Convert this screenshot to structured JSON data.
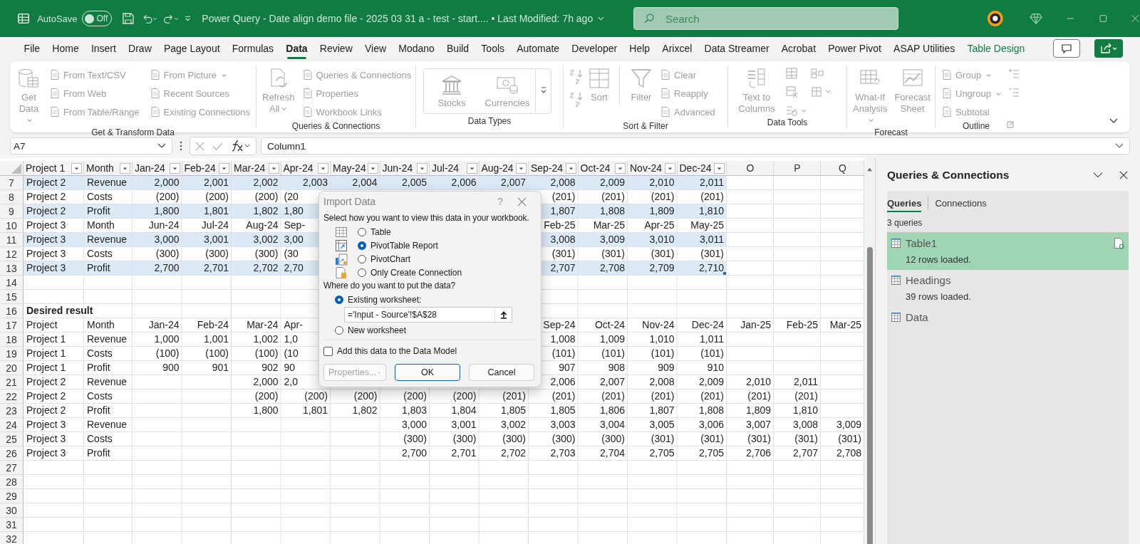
{
  "title_bar": {
    "autosave_label": "AutoSave",
    "autosave": {
      "on": false,
      "label": "Off"
    },
    "title": "Power Query - Date align demo file - 2025 03 31 a - test - start.... • Last Modified: 7h ago",
    "search": {
      "placeholder": "Search"
    }
  },
  "menu_tabs": [
    {
      "label": "File",
      "selected": false,
      "kind": "standard"
    },
    {
      "label": "Home",
      "selected": false,
      "kind": "standard"
    },
    {
      "label": "Insert",
      "selected": false,
      "kind": "standard"
    },
    {
      "label": "Draw",
      "selected": false,
      "kind": "standard"
    },
    {
      "label": "Page Layout",
      "selected": false,
      "kind": "standard"
    },
    {
      "label": "Formulas",
      "selected": false,
      "kind": "standard"
    },
    {
      "label": "Data",
      "selected": true,
      "kind": "standard"
    },
    {
      "label": "Review",
      "selected": false,
      "kind": "standard"
    },
    {
      "label": "View",
      "selected": false,
      "kind": "standard"
    },
    {
      "label": "Modano",
      "selected": false,
      "kind": "standard"
    },
    {
      "label": "Build",
      "selected": false,
      "kind": "standard"
    },
    {
      "label": "Tools",
      "selected": false,
      "kind": "standard"
    },
    {
      "label": "Automate",
      "selected": false,
      "kind": "standard"
    },
    {
      "label": "Developer",
      "selected": false,
      "kind": "standard"
    },
    {
      "label": "Help",
      "selected": false,
      "kind": "standard"
    },
    {
      "label": "Arixcel",
      "selected": false,
      "kind": "standard"
    },
    {
      "label": "Data Streamer",
      "selected": false,
      "kind": "standard"
    },
    {
      "label": "Acrobat",
      "selected": false,
      "kind": "standard"
    },
    {
      "label": "Power Pivot",
      "selected": false,
      "kind": "standard"
    },
    {
      "label": "ASAP Utilities",
      "selected": false,
      "kind": "standard"
    },
    {
      "label": "Table Design",
      "selected": false,
      "kind": "contextual"
    }
  ],
  "ribbon": {
    "disabled": true,
    "groups": [
      {
        "label": "Get & Transform Data",
        "large": [
          {
            "label": "Get Data",
            "caret": true
          }
        ],
        "small": [
          {
            "label": "From Text/CSV",
            "caret": false
          },
          {
            "label": "From Web",
            "caret": false
          },
          {
            "label": "From Table/Range",
            "caret": false
          },
          {
            "label": "From Picture",
            "caret": true
          },
          {
            "label": "Recent Sources",
            "caret": false
          },
          {
            "label": "Existing Connections",
            "caret": false
          }
        ]
      },
      {
        "label": "Queries & Connections",
        "large": [
          {
            "label": "Refresh All",
            "caret": true
          }
        ],
        "small": [
          {
            "label": "Queries & Connections",
            "caret": false
          },
          {
            "label": "Properties",
            "caret": false
          },
          {
            "label": "Workbook Links",
            "caret": false
          }
        ]
      },
      {
        "label": "Data Types",
        "gallery": [
          "Stocks",
          "Currencies"
        ]
      },
      {
        "label": "Sort & Filter",
        "large": [
          {
            "label": "Sort",
            "caret": false
          },
          {
            "label": "Filter",
            "caret": false
          }
        ],
        "small": [
          {
            "label": "Clear",
            "caret": false
          },
          {
            "label": "Reapply",
            "caret": false
          },
          {
            "label": "Advanced",
            "caret": false
          }
        ]
      },
      {
        "label": "Data Tools",
        "large": [
          {
            "label": "Text to Columns",
            "caret": false
          }
        ]
      },
      {
        "label": "Forecast",
        "large": [
          {
            "label": "What-If Analysis",
            "caret": true
          },
          {
            "label": "Forecast Sheet",
            "caret": false
          }
        ]
      },
      {
        "label": "Outline",
        "small": [
          {
            "label": "Group",
            "caret": true
          },
          {
            "label": "Ungroup",
            "caret": true
          },
          {
            "label": "Subtotal",
            "caret": false
          }
        ]
      }
    ]
  },
  "formula_bar": {
    "name_box": "A7",
    "formula": "Column1"
  },
  "sheet": {
    "columns": [
      {
        "label": "Project 1",
        "filter": true
      },
      {
        "label": "Month",
        "filter": true
      },
      {
        "label": "Jan-24",
        "filter": true
      },
      {
        "label": "Feb-24",
        "filter": true
      },
      {
        "label": "Mar-24",
        "filter": true
      },
      {
        "label": "Apr-24",
        "filter": true
      },
      {
        "label": "May-24",
        "filter": true
      },
      {
        "label": "Jun-24",
        "filter": true
      },
      {
        "label": "Jul-24",
        "filter": true
      },
      {
        "label": "Aug-24",
        "filter": true
      },
      {
        "label": "Sep-24",
        "filter": true
      },
      {
        "label": "Oct-24",
        "filter": true
      },
      {
        "label": "Nov-24",
        "filter": true
      },
      {
        "label": "Dec-24",
        "filter": true
      },
      {
        "label": "O",
        "filter": false
      },
      {
        "label": "P",
        "filter": false
      },
      {
        "label": "Q",
        "filter": false
      }
    ],
    "rows": [
      {
        "number": "7",
        "band": true,
        "cells": [
          "Project 2",
          "Revenue",
          "2,000",
          "2,001",
          "2,002",
          "2,003",
          "2,004",
          "2,005",
          "2,006",
          "2,007",
          "2,008",
          "2,009",
          "2,010",
          "2,011"
        ]
      },
      {
        "number": "8",
        "band": false,
        "cells": [
          "Project 2",
          "Costs",
          "(200)",
          "(200)",
          "(200)",
          {
            "text": "(20",
            "cut": true
          },
          null,
          null,
          null,
          null,
          "(201)",
          "(201)",
          "(201)",
          "(201)"
        ]
      },
      {
        "number": "9",
        "band": true,
        "cells": [
          "Project 2",
          "Profit",
          "1,800",
          "1,801",
          "1,802",
          {
            "text": "1,80",
            "cut": true
          },
          null,
          null,
          null,
          null,
          "1,807",
          "1,808",
          "1,809",
          "1,810"
        ]
      },
      {
        "number": "10",
        "band": false,
        "cells": [
          "Project 3",
          "Month",
          "Jun-24",
          "Jul-24",
          "Aug-24",
          {
            "text": "Sep-",
            "cut": true
          },
          null,
          null,
          null,
          null,
          "Feb-25",
          "Mar-25",
          "Apr-25",
          "May-25"
        ]
      },
      {
        "number": "11",
        "band": true,
        "cells": [
          "Project 3",
          "Revenue",
          "3,000",
          "3,001",
          "3,002",
          {
            "text": "3,00",
            "cut": true
          },
          null,
          null,
          null,
          null,
          "3,008",
          "3,009",
          "3,010",
          "3,011"
        ]
      },
      {
        "number": "12",
        "band": false,
        "cells": [
          "Project 3",
          "Costs",
          "(300)",
          "(300)",
          "(300)",
          {
            "text": "(30",
            "cut": true
          },
          null,
          null,
          null,
          null,
          "(301)",
          "(301)",
          "(301)",
          "(301)"
        ]
      },
      {
        "number": "13",
        "band": true,
        "cells": [
          "Project 3",
          "Profit",
          "2,700",
          "2,701",
          "2,702",
          {
            "text": "2,70",
            "cut": true
          },
          null,
          null,
          null,
          null,
          "2,707",
          "2,708",
          "2,709",
          "2,710"
        ]
      },
      {
        "number": "14"
      },
      {
        "number": "15"
      },
      {
        "number": "16",
        "bold": true,
        "cells": [
          "Desired result"
        ]
      },
      {
        "number": "17",
        "cells": [
          "Project",
          "Month",
          "Jan-24",
          "Feb-24",
          "Mar-24",
          {
            "text": "Apr-",
            "cut": true
          },
          null,
          null,
          null,
          null,
          "Sep-24",
          "Oct-24",
          "Nov-24",
          "Dec-24",
          "Jan-25",
          "Feb-25",
          "Mar-25"
        ]
      },
      {
        "number": "18",
        "cells": [
          "Project 1",
          "Revenue",
          "1,000",
          "1,001",
          "1,002",
          {
            "text": "1,0",
            "cut": true
          },
          null,
          null,
          null,
          null,
          "1,008",
          "1,009",
          "1,010",
          "1,011"
        ]
      },
      {
        "number": "19",
        "cells": [
          "Project 1",
          "Costs",
          "(100)",
          "(100)",
          "(100)",
          {
            "text": "(10",
            "cut": true
          },
          null,
          null,
          null,
          null,
          "(101)",
          "(101)",
          "(101)",
          "(101)"
        ]
      },
      {
        "number": "20",
        "cells": [
          "Project 1",
          "Profit",
          "900",
          "901",
          "902",
          {
            "text": "90",
            "cut": true
          },
          null,
          null,
          null,
          null,
          "907",
          "908",
          "909",
          "910"
        ]
      },
      {
        "number": "21",
        "cells": [
          "Project 2",
          "Revenue",
          null,
          null,
          "2,000",
          {
            "text": "2,0",
            "cut": true
          },
          null,
          null,
          null,
          null,
          "2,006",
          "2,007",
          "2,008",
          "2,009",
          "2,010",
          "2,011"
        ]
      },
      {
        "number": "22",
        "cells": [
          "Project 2",
          "Costs",
          null,
          null,
          "(200)",
          "(200)",
          "(200)",
          "(200)",
          "(200)",
          "(201)",
          "(201)",
          "(201)",
          "(201)",
          "(201)",
          "(201)",
          "(201)"
        ]
      },
      {
        "number": "23",
        "cells": [
          "Project 2",
          "Profit",
          null,
          null,
          "1,800",
          "1,801",
          "1,802",
          "1,803",
          "1,804",
          "1,805",
          "1,805",
          "1,806",
          "1,807",
          "1,808",
          "1,809",
          "1,810"
        ]
      },
      {
        "number": "24",
        "cells": [
          "Project 3",
          "Revenue",
          null,
          null,
          null,
          null,
          null,
          "3,000",
          "3,001",
          "3,002",
          "3,003",
          "3,004",
          "3,005",
          "3,006",
          "3,007",
          "3,008",
          "3,009"
        ]
      },
      {
        "number": "25",
        "cells": [
          "Project 3",
          "Costs",
          null,
          null,
          null,
          null,
          null,
          "(300)",
          "(300)",
          "(300)",
          "(300)",
          "(300)",
          "(301)",
          "(301)",
          "(301)",
          "(301)",
          "(301)"
        ]
      },
      {
        "number": "26",
        "cells": [
          "Project 3",
          "Profit",
          null,
          null,
          null,
          null,
          null,
          "2,700",
          "2,701",
          "2,702",
          "2,703",
          "2,704",
          "2,705",
          "2,705",
          "2,706",
          "2,707",
          "2,708"
        ]
      },
      {
        "number": "27"
      },
      {
        "number": "28"
      },
      {
        "number": "29"
      },
      {
        "number": "30"
      },
      {
        "number": "31"
      },
      {
        "number": "32"
      }
    ]
  },
  "dialog": {
    "title": "Import Data",
    "help": "?",
    "prompt": "Select how you want to view this data in your workbook.",
    "view_options": [
      {
        "label": "Table",
        "selected": false
      },
      {
        "label": "PivotTable Report",
        "selected": true
      },
      {
        "label": "PivotChart",
        "selected": false
      },
      {
        "label": "Only Create Connection",
        "selected": false
      }
    ],
    "location_prompt": "Where do you want to put the data?",
    "location_options": [
      {
        "label": "Existing worksheet:",
        "selected": true
      },
      {
        "label": "New worksheet",
        "selected": false
      }
    ],
    "location_value": "='Input - Source'!$A$28",
    "data_model": {
      "label": "Add this data to the Data Model",
      "checked": false
    },
    "buttons": [
      {
        "label": "Properties...",
        "kind": "menu",
        "disabled": true
      },
      {
        "label": "OK",
        "kind": "default",
        "disabled": false
      },
      {
        "label": "Cancel",
        "kind": "plain",
        "disabled": false
      }
    ]
  },
  "pane": {
    "title": "Queries & Connections",
    "tabs": [
      {
        "label": "Queries",
        "selected": true
      },
      {
        "label": "Connections",
        "selected": false
      }
    ],
    "count": "3 queries",
    "queries": [
      {
        "name": "Table1",
        "status": "12 rows loaded.",
        "selected": true
      },
      {
        "name": "Headings",
        "status": "39 rows loaded.",
        "selected": false
      },
      {
        "name": "Data",
        "selected": false
      }
    ]
  }
}
